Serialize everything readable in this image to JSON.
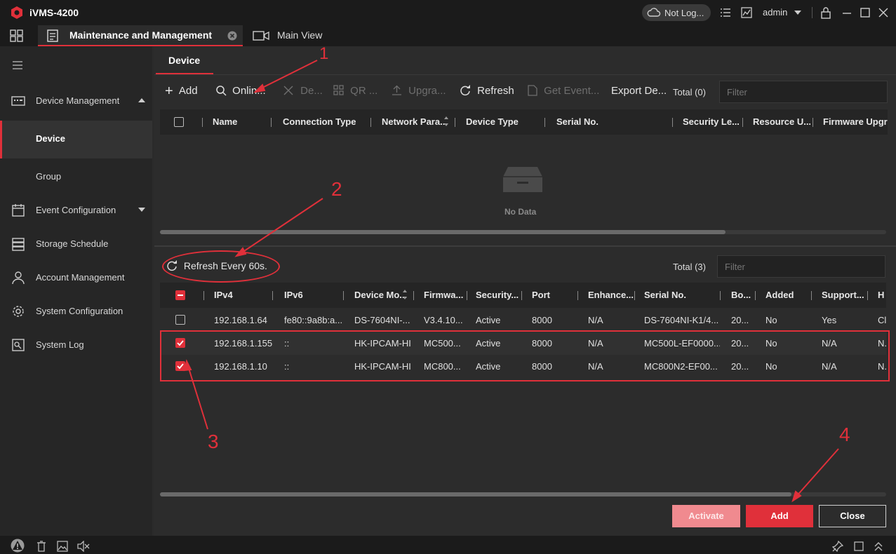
{
  "app": {
    "title": "iVMS-4200",
    "cloud_status": "Not Log...",
    "user": "admin"
  },
  "tabs": {
    "active": "Maintenance and Management",
    "main_view": "Main View"
  },
  "sidebar": {
    "device_management": "Device Management",
    "device": "Device",
    "group": "Group",
    "event_configuration": "Event Configuration",
    "storage_schedule": "Storage Schedule",
    "account_management": "Account Management",
    "system_configuration": "System Configuration",
    "system_log": "System Log"
  },
  "main": {
    "tab": "Device",
    "toolbar": {
      "add": "Add",
      "online": "Onlin...",
      "delete": "De...",
      "qr": "QR ...",
      "upgrade": "Upgra...",
      "refresh": "Refresh",
      "get_event": "Get Event...",
      "export": "Export De..."
    },
    "total_top": "Total (0)",
    "filter_placeholder": "Filter",
    "device_table_headers": [
      "Name",
      "Connection Type",
      "Network Para...",
      "Device Type",
      "Serial No.",
      "Security Le...",
      "Resource U...",
      "Firmware Upgr"
    ],
    "no_data": "No Data",
    "refresh_every": "Refresh Every 60s.",
    "total_bottom": "Total (3)",
    "online_table_headers": [
      "IPv4",
      "IPv6",
      "Device Mo...",
      "Firmwa...",
      "Security...",
      "Port",
      "Enhance...",
      "Serial No.",
      "Bo...",
      "Added",
      "Support...",
      "H"
    ],
    "online_rows": [
      {
        "checked": false,
        "cells": [
          "192.168.1.64",
          "fe80::9a8b:a...",
          "DS-7604NI-...",
          "V3.4.10...",
          "Active",
          "8000",
          "N/A",
          "DS-7604NI-K1/4...",
          "20...",
          "No",
          "Yes",
          "Cl"
        ]
      },
      {
        "checked": true,
        "cells": [
          "192.168.1.155",
          "::",
          "HK-IPCAM-HI",
          "MC500...",
          "Active",
          "8000",
          "N/A",
          "MC500L-EF0000...",
          "20...",
          "No",
          "N/A",
          "N."
        ]
      },
      {
        "checked": true,
        "cells": [
          "192.168.1.10",
          "::",
          "HK-IPCAM-HI",
          "MC800...",
          "Active",
          "8000",
          "N/A",
          "MC800N2-EF00...",
          "20...",
          "No",
          "N/A",
          "N."
        ]
      }
    ],
    "buttons": {
      "activate": "Activate",
      "add": "Add",
      "close": "Close"
    }
  },
  "annotations": [
    "1",
    "2",
    "3",
    "4"
  ],
  "colors": {
    "accent": "#e0303a",
    "background": "#2c2c2c",
    "sidebar": "#262626",
    "titlebar": "#1b1b1b"
  }
}
